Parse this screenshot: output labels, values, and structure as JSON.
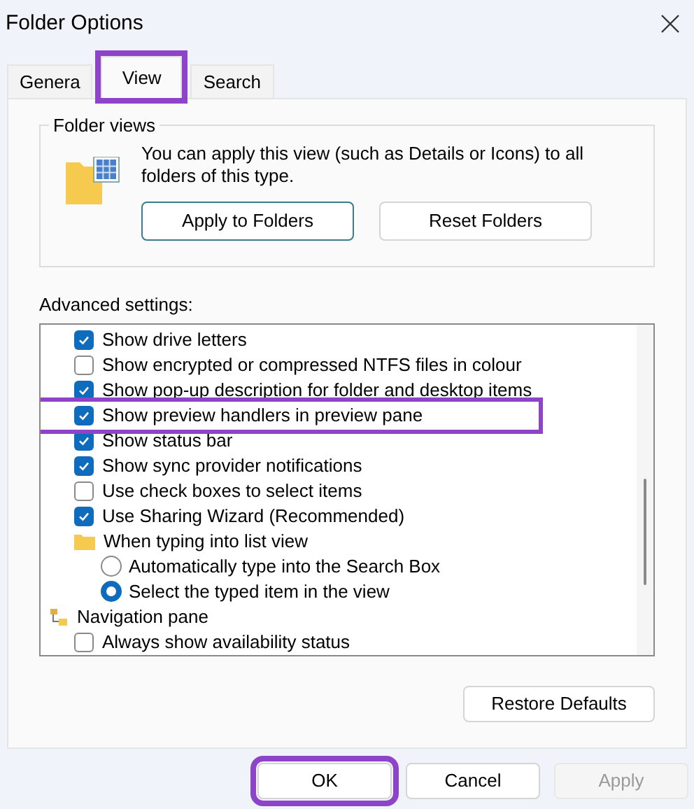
{
  "window": {
    "title": "Folder Options"
  },
  "tabs": [
    {
      "label": "Genera",
      "selected": false,
      "highlighted": false
    },
    {
      "label": "View",
      "selected": true,
      "highlighted": true
    },
    {
      "label": "Search",
      "selected": false,
      "highlighted": false
    }
  ],
  "folder_views": {
    "title": "Folder views",
    "description": "You can apply this view (such as Details or Icons) to all folders of this type.",
    "buttons": [
      {
        "label": "Apply to Folders",
        "focused": true
      },
      {
        "label": "Reset Folders",
        "focused": false
      }
    ]
  },
  "advanced": {
    "label": "Advanced settings:",
    "items": [
      {
        "kind": "checkbox",
        "label": "Show drive letters",
        "checked": true,
        "highlighted": false
      },
      {
        "kind": "checkbox",
        "label": "Show encrypted or compressed NTFS files in colour",
        "checked": false,
        "highlighted": false
      },
      {
        "kind": "checkbox",
        "label": "Show pop-up description for folder and desktop items",
        "checked": true,
        "highlighted": false
      },
      {
        "kind": "checkbox",
        "label": "Show preview handlers in preview pane",
        "checked": true,
        "highlighted": true
      },
      {
        "kind": "checkbox",
        "label": "Show status bar",
        "checked": true,
        "highlighted": false
      },
      {
        "kind": "checkbox",
        "label": "Show sync provider notifications",
        "checked": true,
        "highlighted": false
      },
      {
        "kind": "checkbox",
        "label": "Use check boxes to select items",
        "checked": false,
        "highlighted": false
      },
      {
        "kind": "checkbox",
        "label": "Use Sharing Wizard (Recommended)",
        "checked": true,
        "highlighted": false
      },
      {
        "kind": "folder",
        "label": "When typing into list view",
        "children": [
          {
            "kind": "radio",
            "label": "Automatically type into the Search Box",
            "selected": false
          },
          {
            "kind": "radio",
            "label": "Select the typed item in the view",
            "selected": true
          }
        ]
      },
      {
        "kind": "category",
        "label": "Navigation pane",
        "children": [
          {
            "kind": "checkbox",
            "label": "Always show availability status",
            "checked": false,
            "highlighted": false
          }
        ]
      }
    ],
    "restore_button": "Restore Defaults"
  },
  "footer_buttons": [
    {
      "label": "OK",
      "disabled": false,
      "highlighted": true
    },
    {
      "label": "Cancel",
      "disabled": false,
      "highlighted": false
    },
    {
      "label": "Apply",
      "disabled": true,
      "highlighted": false
    }
  ]
}
